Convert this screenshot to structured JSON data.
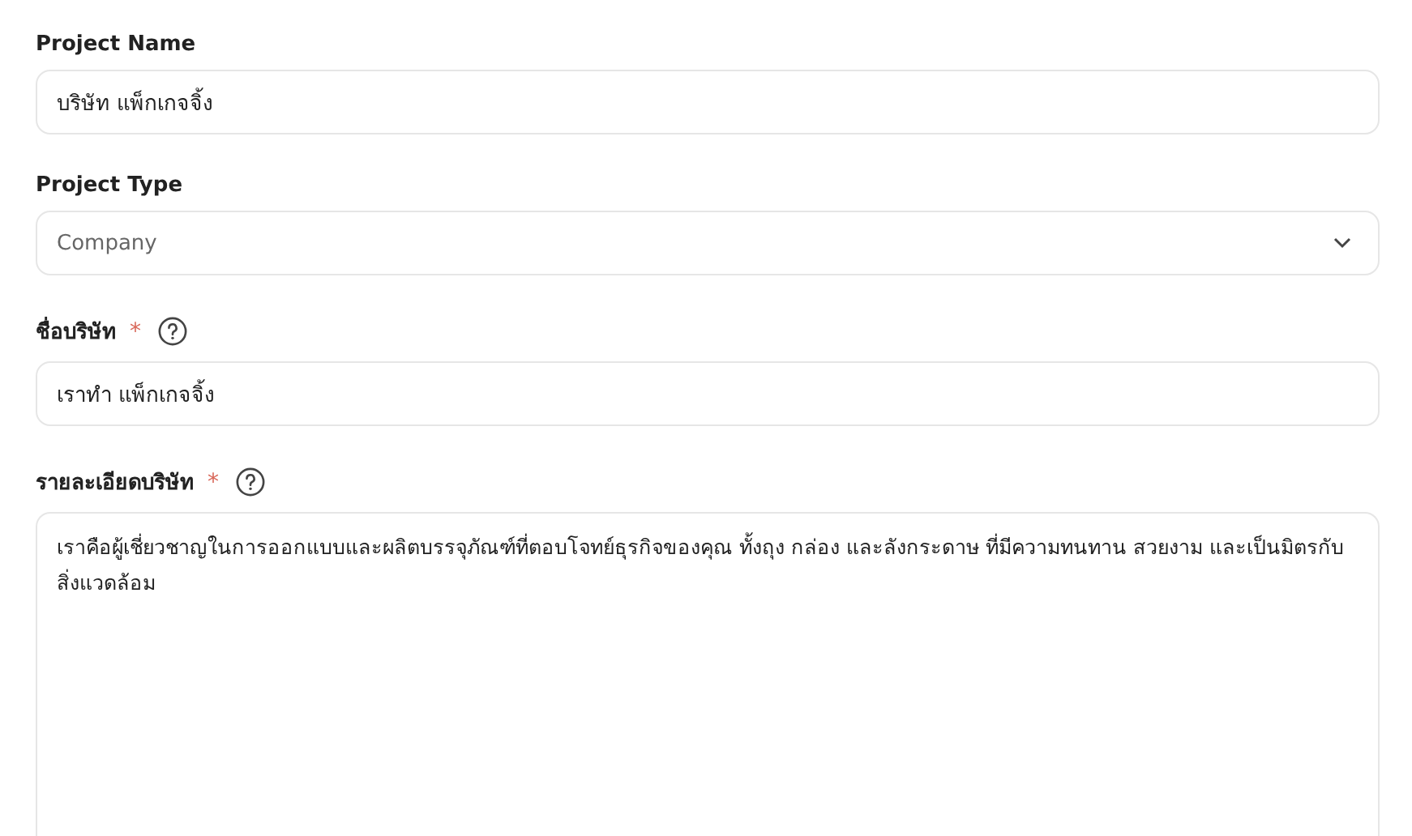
{
  "fields": [
    {
      "kind": "text",
      "label": "Project Name",
      "help": false,
      "value": "บริษัท แพ็กเกจจิ้ง"
    },
    {
      "kind": "select",
      "label": "Project Type",
      "help": false,
      "value": "Company"
    },
    {
      "kind": "text",
      "label": "ชื่อบริษัท",
      "required_mark": "*",
      "help": true,
      "value": "เราทำ แพ็กเกจจิ้ง"
    },
    {
      "kind": "textarea",
      "label": "รายละเอียดบริษัท",
      "required_mark": "*",
      "help": true,
      "value": "เราคือผู้เชี่ยวชาญในการออกแบบและผลิตบรรจุภัณฑ์ที่ตอบโจทย์ธุรกิจของคุณ ทั้งถุง กล่อง และลังกระดาษ ที่มีความทนทาน สวยงาม และเป็นมิตรกับสิ่งแวดล้อม"
    }
  ]
}
